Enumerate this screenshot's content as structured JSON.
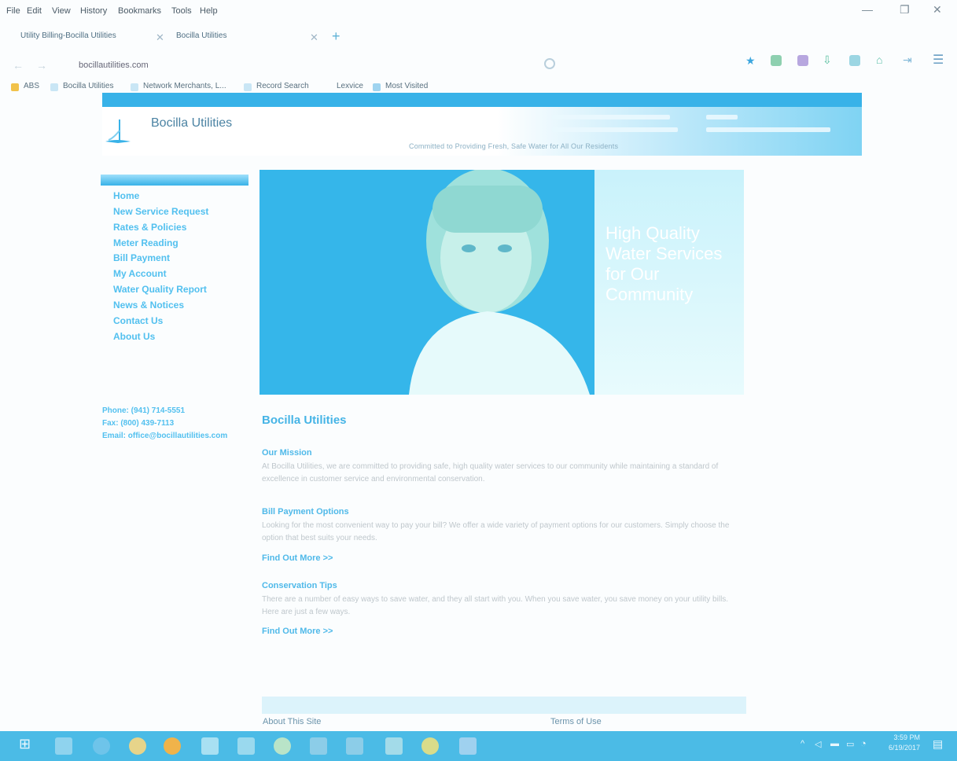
{
  "browser": {
    "menu": [
      "File",
      "Edit",
      "View",
      "History",
      "Bookmarks",
      "Tools",
      "Help"
    ],
    "window_controls": {
      "minimize": "—",
      "restore": "❐",
      "close": "✕"
    },
    "tabs": [
      {
        "label": "Utility Billing-Bocilla Utilities"
      },
      {
        "label": "Bocilla Utilities"
      }
    ],
    "new_tab": "+",
    "tab_close": "✕",
    "url": "bocillautilities.com",
    "bookmarks": [
      "ABS",
      "Bocilla Utilities",
      "Network Merchants, L...",
      "Record Search",
      "Lexvice",
      "Most Visited"
    ]
  },
  "site": {
    "title": "Bocilla Utilities",
    "tagline": "Committed to Providing Fresh, Safe Water for All Our Residents"
  },
  "nav": [
    "Home",
    "New Service Request",
    "Rates & Policies",
    "Meter Reading",
    "Bill Payment",
    "My Account",
    "Water Quality Report",
    "News & Notices",
    "Contact Us",
    "About Us"
  ],
  "contact": {
    "phone": "Phone: (941) 714-5551",
    "fax": "Fax: (800) 439-7113",
    "email": "Email: office@bocillautilities.com"
  },
  "hero": {
    "headline": "High Quality Water Services for Our Community"
  },
  "content": {
    "title": "Bocilla Utilities",
    "sections": [
      {
        "heading": "Our Mission",
        "body": "At Bocilla Utilities, we are committed to providing safe, high quality water services to our community while maintaining a standard of excellence in customer service and environmental conservation.",
        "more": ""
      },
      {
        "heading": "Bill Payment Options",
        "body": "Looking for the most convenient way to pay your bill? We offer a wide variety of payment options for our customers. Simply choose the option that best suits your needs.",
        "more": "Find Out More >>"
      },
      {
        "heading": "Conservation Tips",
        "body": "There are a number of easy ways to save water, and they all start with you. When you save water, you save money on your utility bills. Here are just a few ways.",
        "more": "Find Out More >>"
      }
    ]
  },
  "footer": {
    "about": "About This Site",
    "terms": "Terms of Use"
  },
  "taskbar": {
    "time": "3:59 PM",
    "date": "6/19/2017"
  },
  "colors": {
    "accent": "#38b2e8",
    "link": "#52c0ef",
    "taskbar": "#4bbbe6"
  }
}
